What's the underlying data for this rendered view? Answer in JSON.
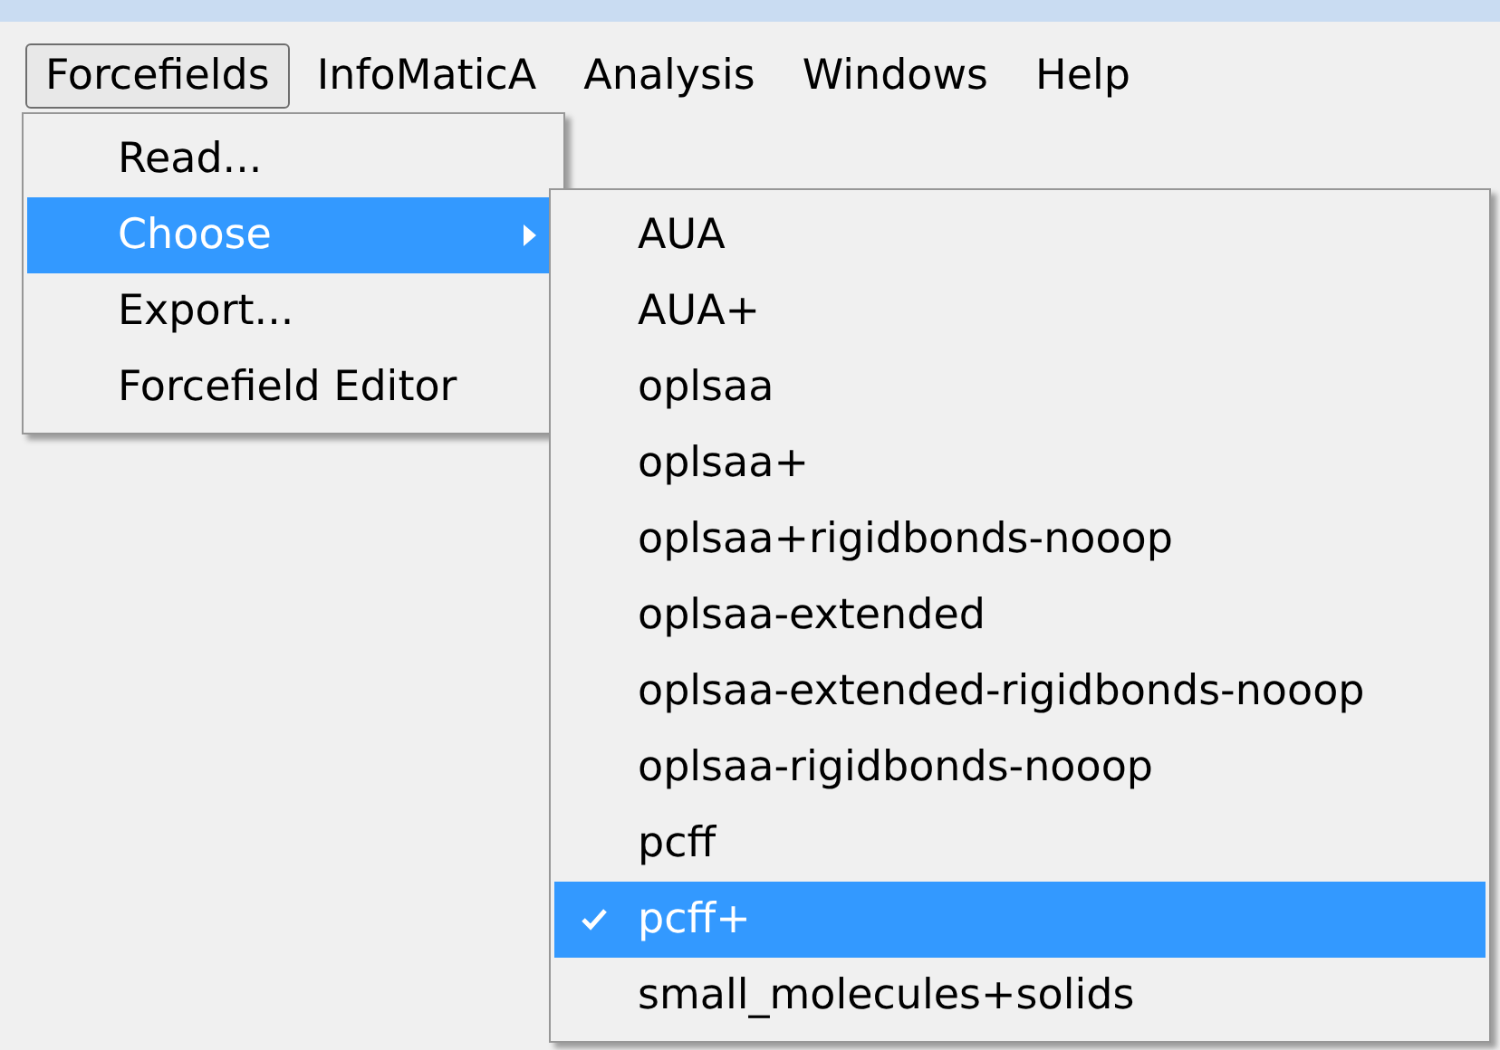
{
  "menu_bar": [
    {
      "label": "Forcefields",
      "selected": true
    },
    {
      "label": "InfoMaticA",
      "selected": false
    },
    {
      "label": "Analysis",
      "selected": false
    },
    {
      "label": "Windows",
      "selected": false
    },
    {
      "label": "Help",
      "selected": false
    }
  ],
  "menu": [
    {
      "label": "Read...",
      "selected": false,
      "has_submenu": false
    },
    {
      "label": "Choose",
      "selected": true,
      "has_submenu": true
    },
    {
      "label": "Export...",
      "selected": false,
      "has_submenu": false
    },
    {
      "label": "Forcefield Editor",
      "selected": false,
      "has_submenu": false
    }
  ],
  "submenu": [
    {
      "label": "AUA",
      "selected": false,
      "checked": false
    },
    {
      "label": "AUA+",
      "selected": false,
      "checked": false
    },
    {
      "label": "oplsaa",
      "selected": false,
      "checked": false
    },
    {
      "label": "oplsaa+",
      "selected": false,
      "checked": false
    },
    {
      "label": "oplsaa+rigidbonds-nooop",
      "selected": false,
      "checked": false
    },
    {
      "label": "oplsaa-extended",
      "selected": false,
      "checked": false
    },
    {
      "label": "oplsaa-extended-rigidbonds-nooop",
      "selected": false,
      "checked": false
    },
    {
      "label": "oplsaa-rigidbonds-nooop",
      "selected": false,
      "checked": false
    },
    {
      "label": "pcff",
      "selected": false,
      "checked": false
    },
    {
      "label": "pcff+",
      "selected": true,
      "checked": true
    },
    {
      "label": "small_molecules+solids",
      "selected": false,
      "checked": false
    }
  ]
}
